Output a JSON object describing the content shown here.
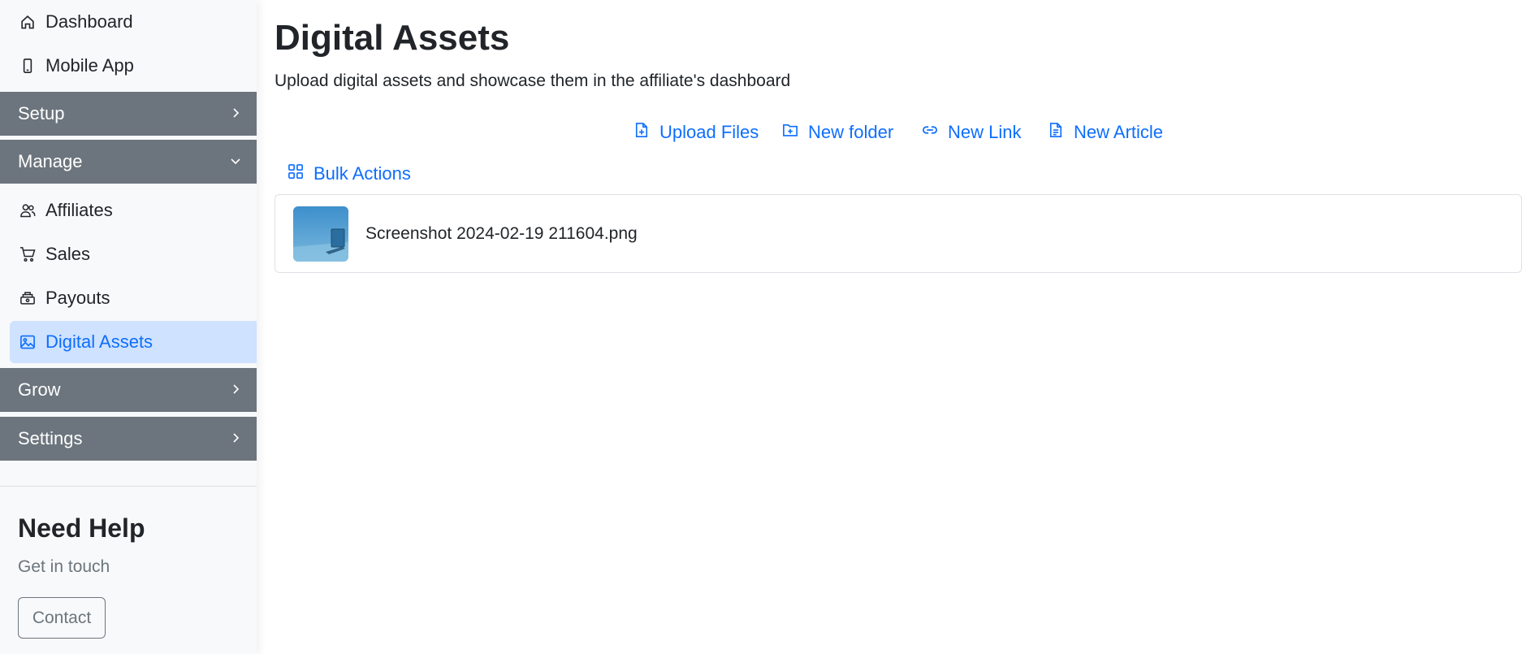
{
  "sidebar": {
    "top_items": [
      {
        "label": "Dashboard",
        "icon": "home-icon"
      },
      {
        "label": "Mobile App",
        "icon": "phone-icon"
      }
    ],
    "sections": {
      "setup": {
        "label": "Setup",
        "expanded": false
      },
      "manage": {
        "label": "Manage",
        "expanded": true
      },
      "grow": {
        "label": "Grow",
        "expanded": false
      },
      "settings": {
        "label": "Settings",
        "expanded": false
      }
    },
    "manage_items": [
      {
        "label": "Affiliates",
        "icon": "people-icon"
      },
      {
        "label": "Sales",
        "icon": "cart-icon"
      },
      {
        "label": "Payouts",
        "icon": "cash-icon"
      },
      {
        "label": "Digital Assets",
        "icon": "image-icon",
        "active": true
      }
    ],
    "help": {
      "title": "Need Help",
      "subtitle": "Get in touch",
      "contact_label": "Contact"
    }
  },
  "main": {
    "title": "Digital Assets",
    "subtitle": "Upload digital assets and showcase them in the affiliate's dashboard",
    "actions": [
      {
        "label": "Upload Files",
        "icon": "file-plus-icon"
      },
      {
        "label": "New folder",
        "icon": "folder-plus-icon"
      },
      {
        "label": "New Link",
        "icon": "link-icon"
      },
      {
        "label": "New Article",
        "icon": "file-text-icon"
      }
    ],
    "bulk_label": "Bulk Actions",
    "assets": [
      {
        "name": "Screenshot 2024-02-19 211604.png"
      }
    ]
  },
  "colors": {
    "accent": "#0d6efd",
    "active_bg": "#cfe2ff",
    "section_bg": "#6c757d",
    "sidebar_bg": "#f8f9fa"
  }
}
